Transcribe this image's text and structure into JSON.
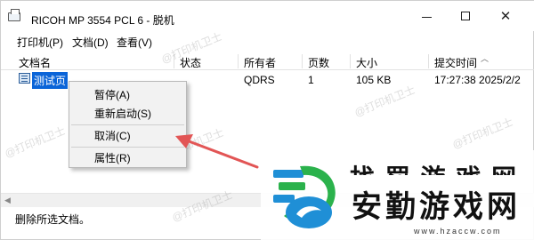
{
  "window": {
    "title": "RICOH MP 3554 PCL 6 - 脱机",
    "controls": {
      "minimize": "minimize",
      "maximize": "maximize",
      "close": "✕"
    }
  },
  "menubar": {
    "items": [
      "打印机(P)",
      "文档(D)",
      "查看(V)"
    ]
  },
  "table": {
    "columns": [
      "文档名",
      "状态",
      "所有者",
      "页数",
      "大小",
      "提交时间"
    ],
    "rows": [
      {
        "name": "测试页",
        "status": "",
        "owner": "QDRS",
        "pages": "1",
        "size": "105 KB",
        "time": "17:27:38   2025/2/2"
      }
    ]
  },
  "context_menu": {
    "items": [
      "暂停(A)",
      "重新启动(S)",
      "取消(C)",
      "属性(R)"
    ]
  },
  "statusbar": {
    "text": "删除所选文档。"
  },
  "watermarks": [
    "@打印机卫士"
  ],
  "brand_overlay": {
    "top_text": "找 罚 游 戏 网",
    "main_text": "安勤游戏网",
    "url": "www.hzaccw.com"
  },
  "colors": {
    "selection": "#0a64d8",
    "arrow": "#e25555",
    "logo_blue": "#1f8fd6",
    "logo_green": "#2bb24c"
  }
}
